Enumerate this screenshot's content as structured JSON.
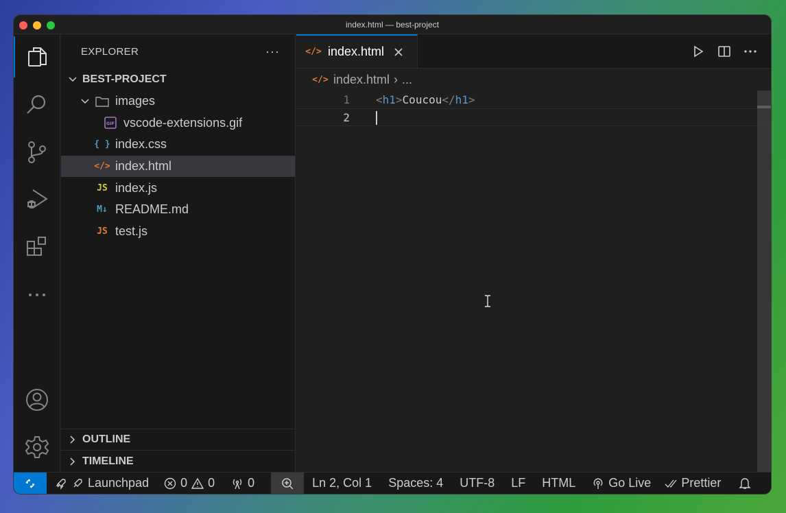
{
  "window": {
    "title": "index.html — best-project"
  },
  "sidebar": {
    "header": "EXPLORER",
    "more": "···",
    "project": "BEST-PROJECT",
    "tree": [
      {
        "label": "images",
        "icon": "folder-icon",
        "indent": 1,
        "expanded": true
      },
      {
        "label": "vscode-extensions.gif",
        "icon": "gif-file-icon",
        "icon_text": "GIF",
        "indent": 2
      },
      {
        "label": "index.css",
        "icon": "css-file-icon",
        "icon_text": "{ }",
        "indent": 1
      },
      {
        "label": "index.html",
        "icon": "html-file-icon",
        "icon_text": "</>",
        "indent": 1,
        "selected": true
      },
      {
        "label": "index.js",
        "icon": "js-file-icon",
        "icon_text": "JS",
        "indent": 1
      },
      {
        "label": "README.md",
        "icon": "markdown-file-icon",
        "icon_text": "M↓",
        "indent": 1
      },
      {
        "label": "test.js",
        "icon": "js-file-icon",
        "icon_text": "JS",
        "indent": 1
      }
    ],
    "outline": "OUTLINE",
    "timeline": "TIMELINE"
  },
  "editor": {
    "tab_label": "index.html",
    "breadcrumb_file": "index.html",
    "breadcrumb_sep": "›",
    "breadcrumb_more": "...",
    "lines": [
      {
        "number": "1",
        "open_br": "<",
        "open_tag": "h1",
        "close_gt": ">",
        "text": "Coucou",
        "close_br": "</",
        "close_tag": "h1",
        "end_gt": ">"
      },
      {
        "number": "2"
      }
    ]
  },
  "statusbar": {
    "launchpad": "Launchpad",
    "errors": "0",
    "warnings": "0",
    "ports": "0",
    "position": "Ln 2, Col 1",
    "spaces": "Spaces: 4",
    "encoding": "UTF-8",
    "eol": "LF",
    "language": "HTML",
    "golive": "Go Live",
    "prettier": "Prettier"
  },
  "colors": {
    "accent": "#0078d4",
    "html": "#e37933",
    "css": "#519aba",
    "js": "#cbcb41",
    "js_test": "#e37933",
    "markdown": "#519aba",
    "gif": "#a074c4"
  }
}
